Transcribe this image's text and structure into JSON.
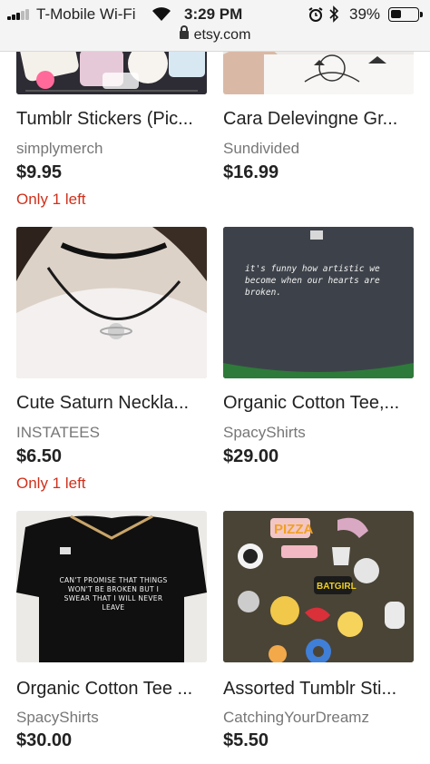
{
  "status_bar": {
    "carrier": "T-Mobile Wi-Fi",
    "time": "3:29 PM",
    "battery_percent": "39%",
    "battery_level": 0.39,
    "icons": [
      "signal-icon",
      "wifi-icon",
      "alarm-icon",
      "bluetooth-icon",
      "battery-icon"
    ]
  },
  "browser": {
    "url": "etsy.com",
    "lock_icon": "lock-icon"
  },
  "listings": [
    {
      "title": "Tumblr Stickers (Pic...",
      "shop": "simplymerch",
      "price": "$9.95",
      "stock": "Only 1 left"
    },
    {
      "title": "Cara Delevingne Gr...",
      "shop": "Sundivided",
      "price": "$16.99",
      "stock": ""
    },
    {
      "title": "Cute Saturn Neckla...",
      "shop": "INSTATEES",
      "price": "$6.50",
      "stock": "Only 1 left"
    },
    {
      "title": "Organic Cotton Tee,...",
      "shop": "SpacyShirts",
      "price": "$29.00",
      "stock": ""
    },
    {
      "title": "Organic Cotton Tee ...",
      "shop": "SpacyShirts",
      "price": "$30.00",
      "stock": ""
    },
    {
      "title": "Assorted Tumblr Sti...",
      "shop": "CatchingYourDreamz",
      "price": "$5.50",
      "stock": ""
    }
  ],
  "image_text": {
    "tee_quote": "it's funny how artistic we become when our hearts are broken.",
    "tee_promise": "CAN'T PROMISE THAT THINGS WON'T BE BROKEN BUT I SWEAR THAT I WILL NEVER LEAVE",
    "sticker_pizza": "PIZZA",
    "sticker_batgirl": "BATGIRL"
  },
  "colors": {
    "low_stock": "#d0301b",
    "shop_name": "#777777",
    "text": "#222222"
  }
}
